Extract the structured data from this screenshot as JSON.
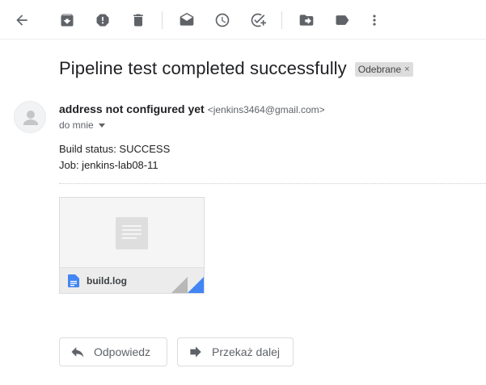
{
  "toolbar": {
    "back": "back-arrow-icon",
    "archive": "archive-icon",
    "spam": "report-spam-icon",
    "delete": "delete-icon",
    "mark_unread": "mark-unread-icon",
    "snooze": "snooze-icon",
    "add_task": "add-task-icon",
    "move_to": "move-to-icon",
    "labels": "label-icon",
    "more": "more-vert-icon"
  },
  "email": {
    "subject": "Pipeline test completed successfully",
    "label": "Odebrane",
    "label_remove": "×",
    "sender_name": "address not configured yet",
    "sender_email": "<jenkins3464@gmail.com>",
    "recipient": "do mnie",
    "body_lines": [
      "Build status: SUCCESS",
      "Job: jenkins-lab08-11"
    ]
  },
  "attachment": {
    "name": "build.log",
    "icon": "document-icon"
  },
  "actions": {
    "reply": "Odpowiedz",
    "forward": "Przekaż dalej"
  },
  "colors": {
    "icon": "#5f6368",
    "label_bg": "#dddddd",
    "attachment_accent": "#4285f4"
  }
}
